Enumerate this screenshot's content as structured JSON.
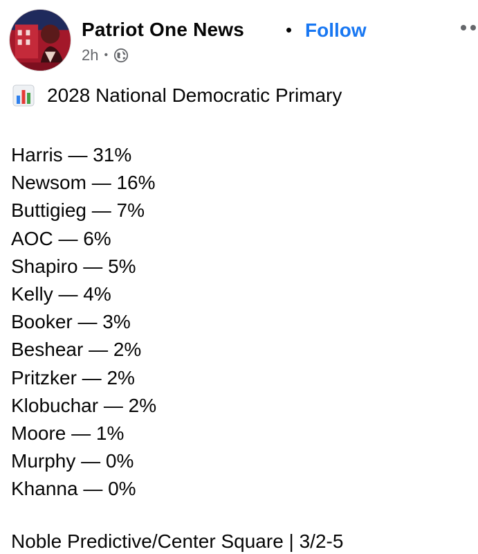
{
  "header": {
    "page_name": "Patriot One News",
    "separator": "•",
    "follow_label": "Follow",
    "time_ago": "2h",
    "meta_separator": "•",
    "avatar_icon": "patriot-one-news-avatar",
    "privacy_icon": "globe-icon",
    "more_icon": "more-options-icon",
    "follow_color": "#1877f2"
  },
  "post": {
    "title_icon": "bar-chart-emoji-icon",
    "title": "2028 National Democratic Primary",
    "results": [
      "Harris — 31%",
      "Newsom — 16%",
      "Buttigieg — 7%",
      "AOC — 6%",
      "Shapiro — 5%",
      "Kelly — 4%",
      "Booker — 3%",
      "Beshear — 2%",
      "Pritzker — 2%",
      "Klobuchar — 2%",
      "Moore — 1%",
      "Murphy — 0%",
      "Khanna — 0%"
    ],
    "source": "Noble Predictive/Center Square | 3/2-5"
  }
}
